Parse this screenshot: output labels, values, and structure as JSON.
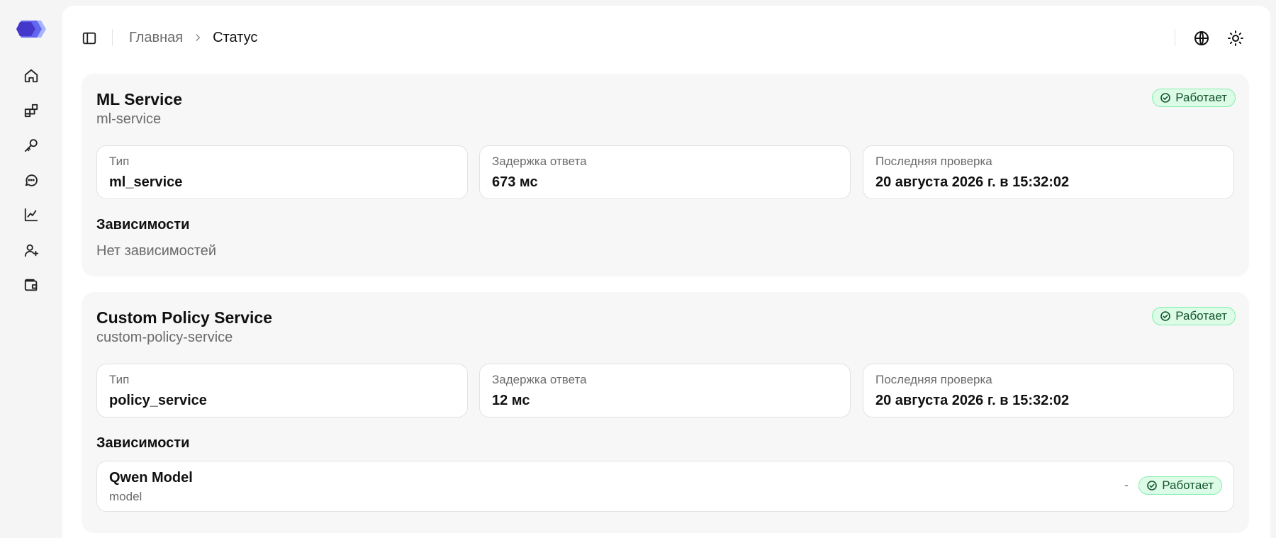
{
  "sidebar": {
    "logo_icon": "app-logo",
    "items": [
      {
        "icon": "home-icon"
      },
      {
        "icon": "apps-icon"
      },
      {
        "icon": "key-icon"
      },
      {
        "icon": "chat-icon"
      },
      {
        "icon": "chart-icon"
      },
      {
        "icon": "user-plus-icon"
      },
      {
        "icon": "wallet-icon"
      }
    ]
  },
  "header": {
    "breadcrumb": {
      "home": "Главная",
      "current": "Статус"
    },
    "actions": [
      {
        "icon": "globe-icon"
      },
      {
        "icon": "sun-icon"
      }
    ]
  },
  "colors": {
    "accent": "#4f46e5",
    "status_ok_bg": "#dcfce7",
    "status_ok_border": "#86efac",
    "status_ok_text": "#14532d"
  },
  "services": [
    {
      "name": "ML Service",
      "slug": "ml-service",
      "status": "Работает",
      "fields": [
        {
          "label": "Тип",
          "value": "ml_service"
        },
        {
          "label": "Задержка ответа",
          "value": "673 мс"
        },
        {
          "label": "Последняя проверка",
          "value": "20 августа 2026 г. в 15:32:02"
        }
      ],
      "dependencies_title": "Зависимости",
      "dependencies_empty": "Нет зависимостей",
      "dependencies": []
    },
    {
      "name": "Custom Policy Service",
      "slug": "custom-policy-service",
      "status": "Работает",
      "fields": [
        {
          "label": "Тип",
          "value": "policy_service"
        },
        {
          "label": "Задержка ответа",
          "value": "12 мс"
        },
        {
          "label": "Последняя проверка",
          "value": "20 августа 2026 г. в 15:32:02"
        }
      ],
      "dependencies_title": "Зависимости",
      "dependencies": [
        {
          "name": "Qwen Model",
          "type": "model",
          "latency": "-",
          "status": "Работает"
        }
      ]
    }
  ]
}
